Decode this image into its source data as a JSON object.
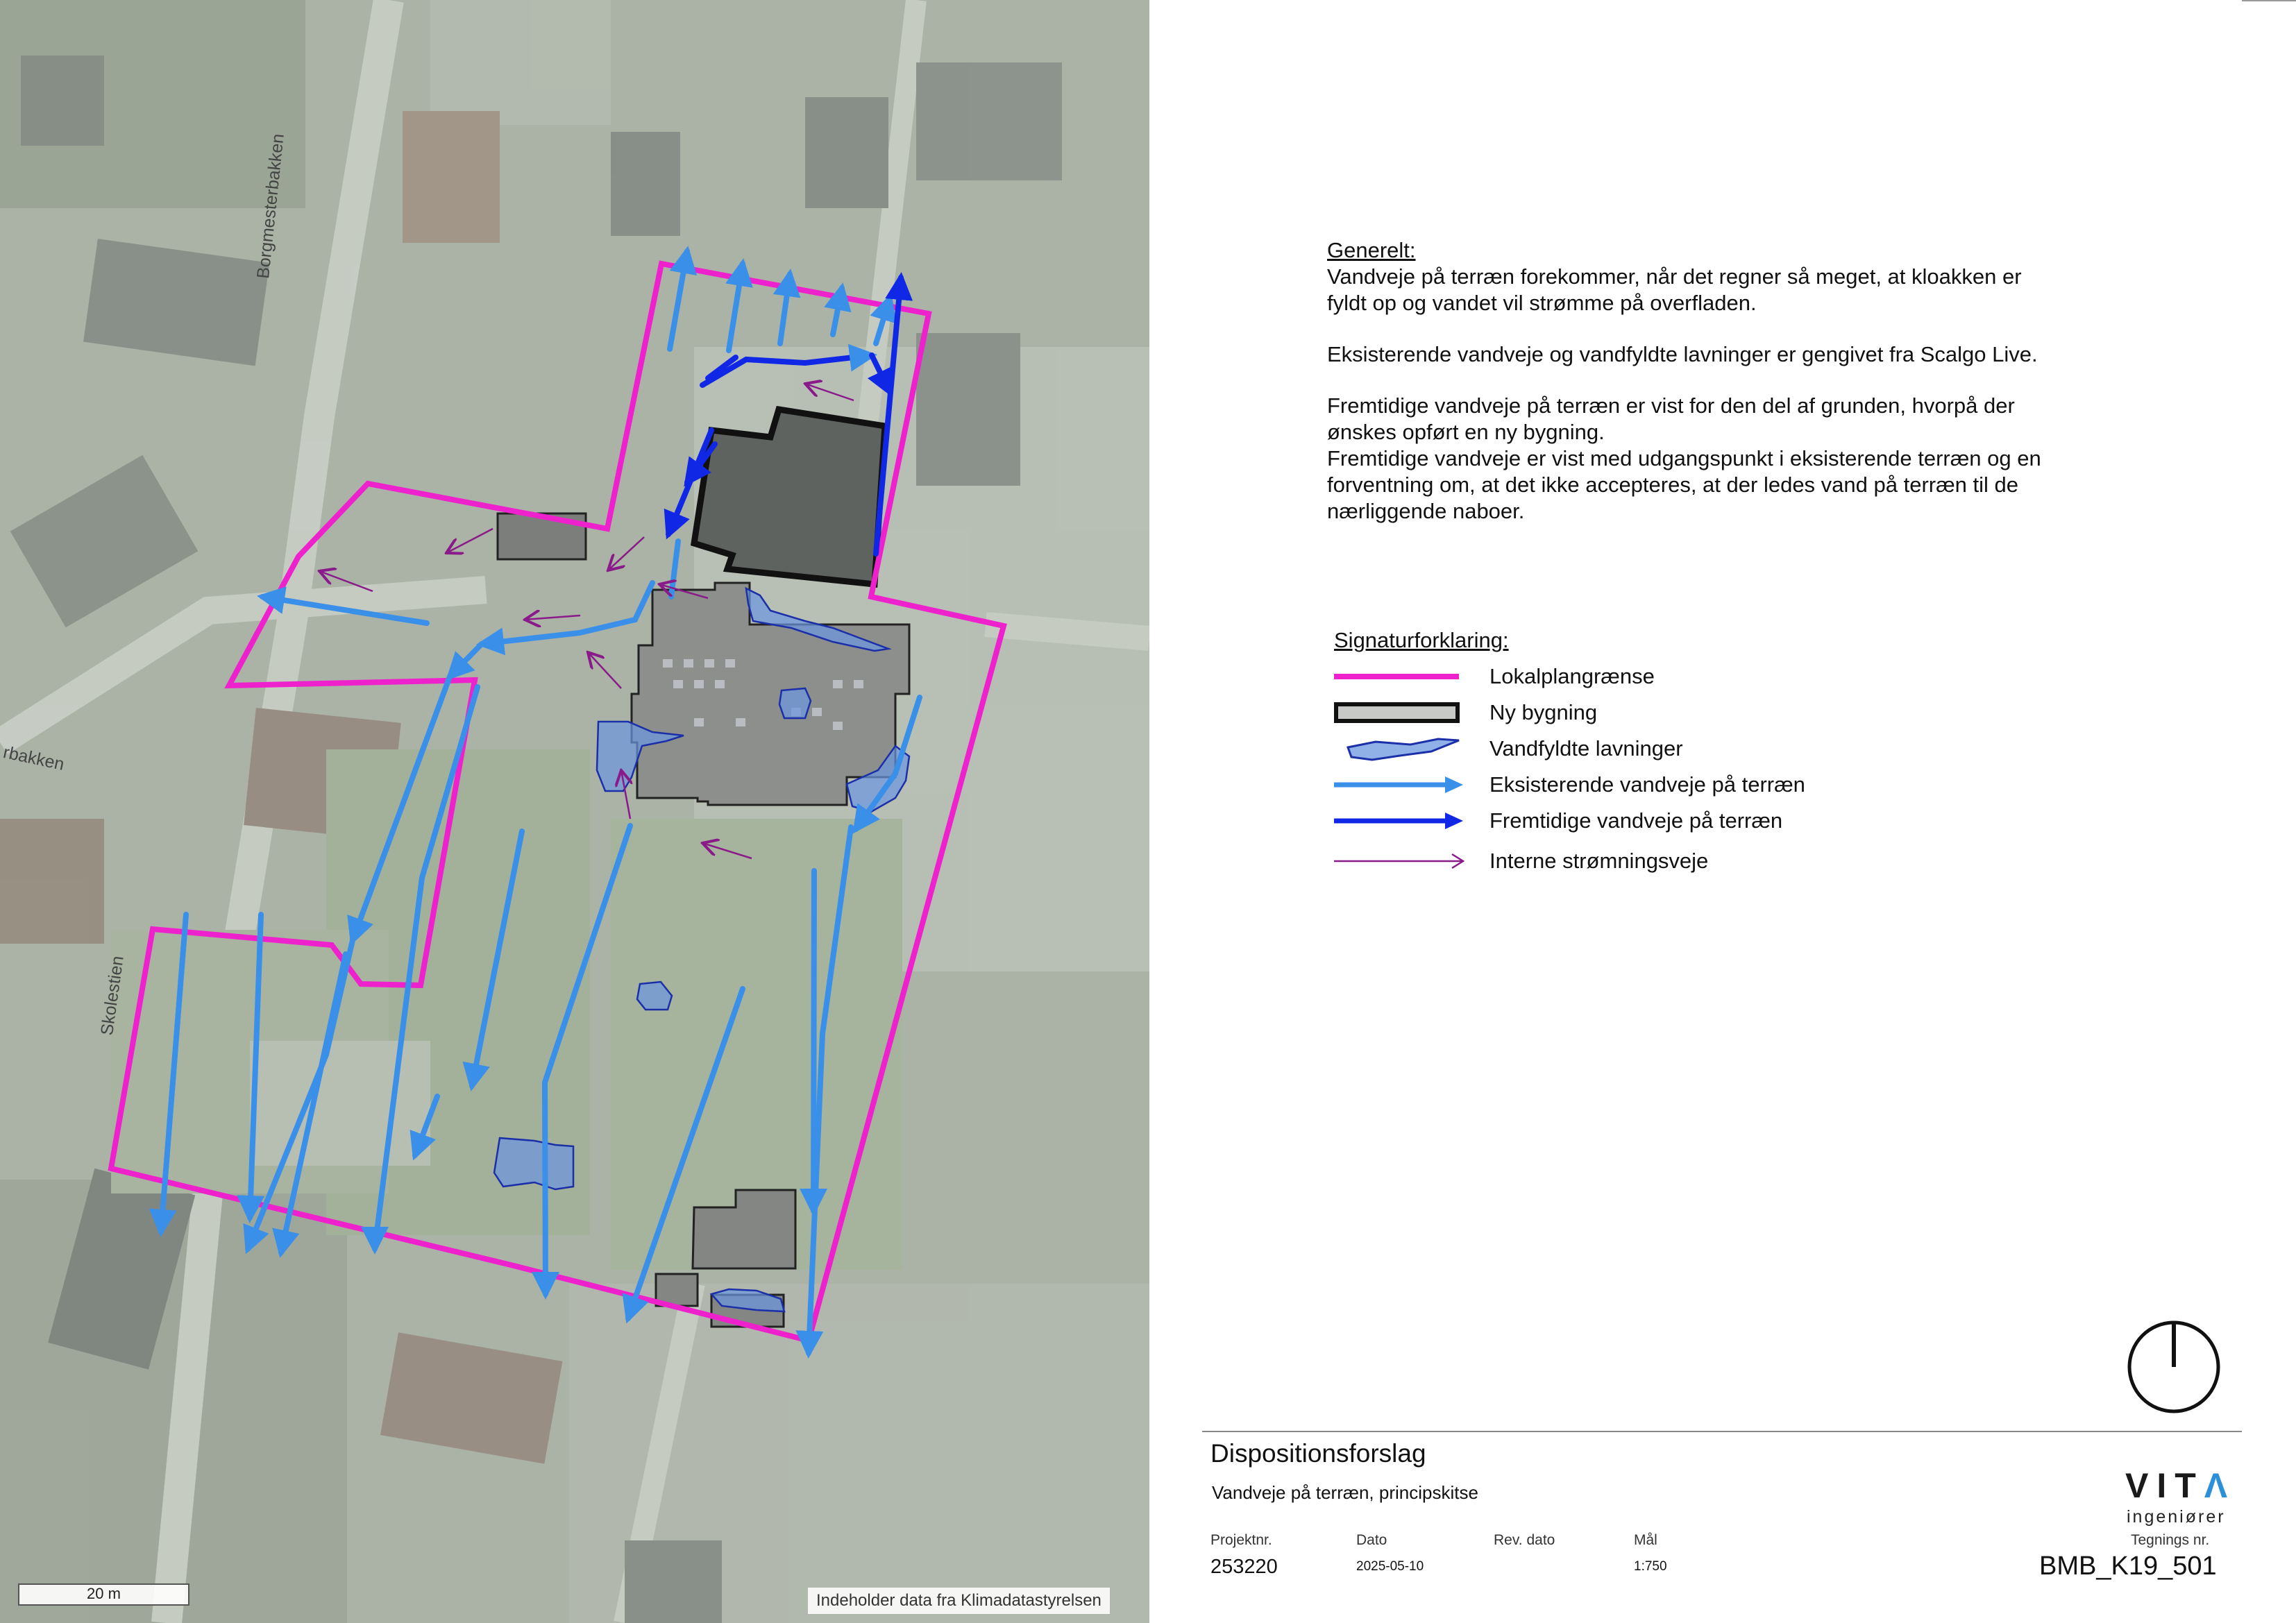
{
  "notes": {
    "heading": "Generelt:",
    "lines_1": [
      "Vandveje på terræn forekommer, når det regner så meget, at kloakken er",
      "fyldt op og vandet vil strømme på overfladen."
    ],
    "line_2": "Eksisterende vandveje og vandfyldte lavninger er gengivet fra Scalgo Live.",
    "lines_3": [
      "Fremtidige vandveje på terræn er vist for den del af grunden, hvorpå der",
      "ønskes opført en ny bygning.",
      "Fremtidige vandveje er vist med udgangspunkt i eksisterende terræn og en",
      "forventning om, at det ikke accepteres, at der ledes vand på terræn til de",
      "nærliggende naboer."
    ]
  },
  "legend": {
    "title": "Signaturforklaring:",
    "items": [
      {
        "key": "lokalplan",
        "label": "Lokalplangrænse",
        "color": "#ee22cc"
      },
      {
        "key": "ny_bygning",
        "label": "Ny bygning",
        "color": "#111111"
      },
      {
        "key": "lavninger",
        "label": "Vandfyldte lavninger",
        "color": "#6b95e0"
      },
      {
        "key": "eksisterende",
        "label": "Eksisterende vandveje på terræn",
        "color": "#3a8fe8"
      },
      {
        "key": "fremtidige",
        "label": "Fremtidige vandveje på terræn",
        "color": "#1028e6"
      },
      {
        "key": "interne",
        "label": "Interne strømningsveje",
        "color": "#8a1a8a"
      }
    ]
  },
  "map": {
    "streets": [
      "Borgmesterbakken",
      "rbakken",
      "Skolestien"
    ],
    "scale_label": "20 m",
    "attribution": "Indeholder data fra Klimadatastyrelsen"
  },
  "titleblock": {
    "title": "Dispositionsforslag",
    "subtitle": "Vandveje på terræn, principskitse",
    "project_label": "Projektnr.",
    "project_value": "253220",
    "date_label": "Dato",
    "date_value": "2025-05-10",
    "rev_label": "Rev. dato",
    "rev_value": "",
    "scale_label": "Mål",
    "scale_value": "1:750",
    "drawing_label": "Tegnings nr.",
    "drawing_value": "BMB_K19_501",
    "logo_text": "VITA",
    "logo_sub": "ingeniører"
  },
  "north_icon": "north-arrow-icon"
}
